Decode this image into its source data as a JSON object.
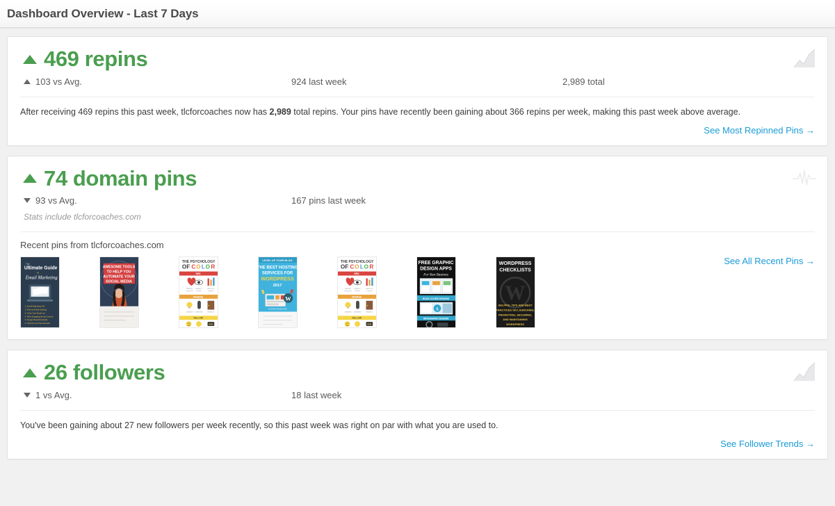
{
  "header": {
    "title": "Dashboard Overview - Last 7 Days"
  },
  "colors": {
    "accent_green": "#4a9e4f",
    "link_blue": "#1a9bd7",
    "page_bg": "#f1f1f1",
    "card_bg": "#ffffff",
    "body_text": "#3b3b3b"
  },
  "cards": [
    {
      "id": "repins",
      "headline_value": "469",
      "headline_unit": "repins",
      "headline_full": "469 repins",
      "headline_direction": "up",
      "icon": "area-chart-icon",
      "substats": [
        {
          "direction": "up",
          "text": "103 vs Avg."
        },
        {
          "direction": "none",
          "text": "924 last week"
        },
        {
          "direction": "none",
          "text": "2,989 total"
        }
      ],
      "description_pre": "After receiving 469 repins this past week, tlcforcoaches now has ",
      "description_bold": "2,989",
      "description_post": " total repins. Your pins have recently been gaining about 366 repins per week, making this past week above average.",
      "cta_label": "See Most Repinned Pins →"
    },
    {
      "id": "domain-pins",
      "headline_value": "74",
      "headline_unit": "domain pins",
      "headline_full": "74 domain pins",
      "headline_direction": "up",
      "icon": "pulse-line-icon",
      "substats": [
        {
          "direction": "down",
          "text": "93 vs Avg."
        },
        {
          "direction": "none",
          "text": "167 pins last week"
        }
      ],
      "stats_note": "Stats include tlcforcoaches.com",
      "pins_label": "Recent pins from tlcforcoaches.com",
      "cta_label": "See All Recent Pins →",
      "pins": [
        {
          "name": "pin-ultimate-guide-email-marketing",
          "title": "The Ultimate Guide to Email Marketing"
        },
        {
          "name": "pin-awesome-tools-social-media",
          "title": "Awesome Tools To Help You Automate Your Social Media"
        },
        {
          "name": "pin-psychology-of-color-1",
          "title": "The Psychology Of Color"
        },
        {
          "name": "pin-best-hosting-wordpress",
          "title": "Level Up Your Blog - The Best Hosting Services For WordPress 2017"
        },
        {
          "name": "pin-psychology-of-color-2",
          "title": "The Psychology Of Color"
        },
        {
          "name": "pin-free-graphic-design-apps",
          "title": "Free Graphic Design Apps For Your Business"
        },
        {
          "name": "pin-wordpress-checklists",
          "title": "WordPress Checklists - Helpful Tips And Best Practices On Launching, Promoting, Securing, And Maintaining WordPress"
        }
      ]
    },
    {
      "id": "followers",
      "headline_value": "26",
      "headline_unit": "followers",
      "headline_full": "26 followers",
      "headline_direction": "up",
      "icon": "area-chart-icon",
      "substats": [
        {
          "direction": "down",
          "text": "1 vs Avg."
        },
        {
          "direction": "none",
          "text": "18 last week"
        }
      ],
      "description_full": "You've been gaining about 27 new followers per week recently, so this past week was right on par with what you are used to.",
      "cta_label": "See Follower Trends →"
    }
  ]
}
